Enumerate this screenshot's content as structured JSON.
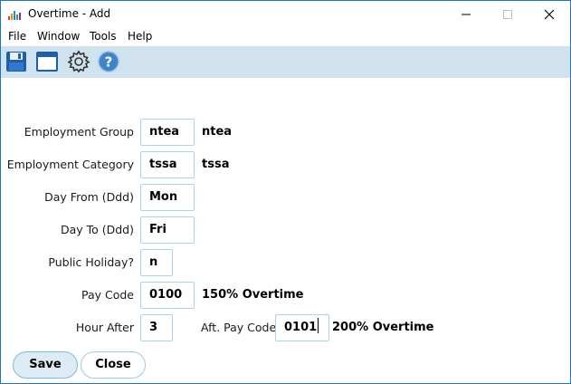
{
  "window": {
    "title": "Overtime - Add"
  },
  "menu": {
    "items": [
      "File",
      "Window",
      "Tools",
      "Help"
    ]
  },
  "toolbar": {
    "icons": [
      "save-icon",
      "window-icon",
      "settings-icon",
      "help-icon"
    ]
  },
  "form": {
    "employment_group": {
      "label": "Employment Group",
      "value": "ntea",
      "desc": "ntea"
    },
    "employment_category": {
      "label": "Employment Category",
      "value": "tssa",
      "desc": "tssa"
    },
    "day_from": {
      "label": "Day From (Ddd)",
      "value": "Mon"
    },
    "day_to": {
      "label": "Day To (Ddd)",
      "value": "Fri"
    },
    "public_holiday": {
      "label": "Public Holiday?",
      "value": "n"
    },
    "pay_code": {
      "label": "Pay Code",
      "value": "0100",
      "desc": "150% Overtime"
    },
    "hour_after": {
      "label": "Hour After",
      "value": "3"
    },
    "aft_pay_code": {
      "label": "Aft. Pay Code",
      "value": "0101",
      "desc": "200% Overtime"
    }
  },
  "buttons": {
    "save": "Save",
    "close": "Close"
  },
  "colors": {
    "border": "#1c73c9",
    "toolbar_bg": "#cfe2ee",
    "field_border": "#a9d3e8"
  }
}
